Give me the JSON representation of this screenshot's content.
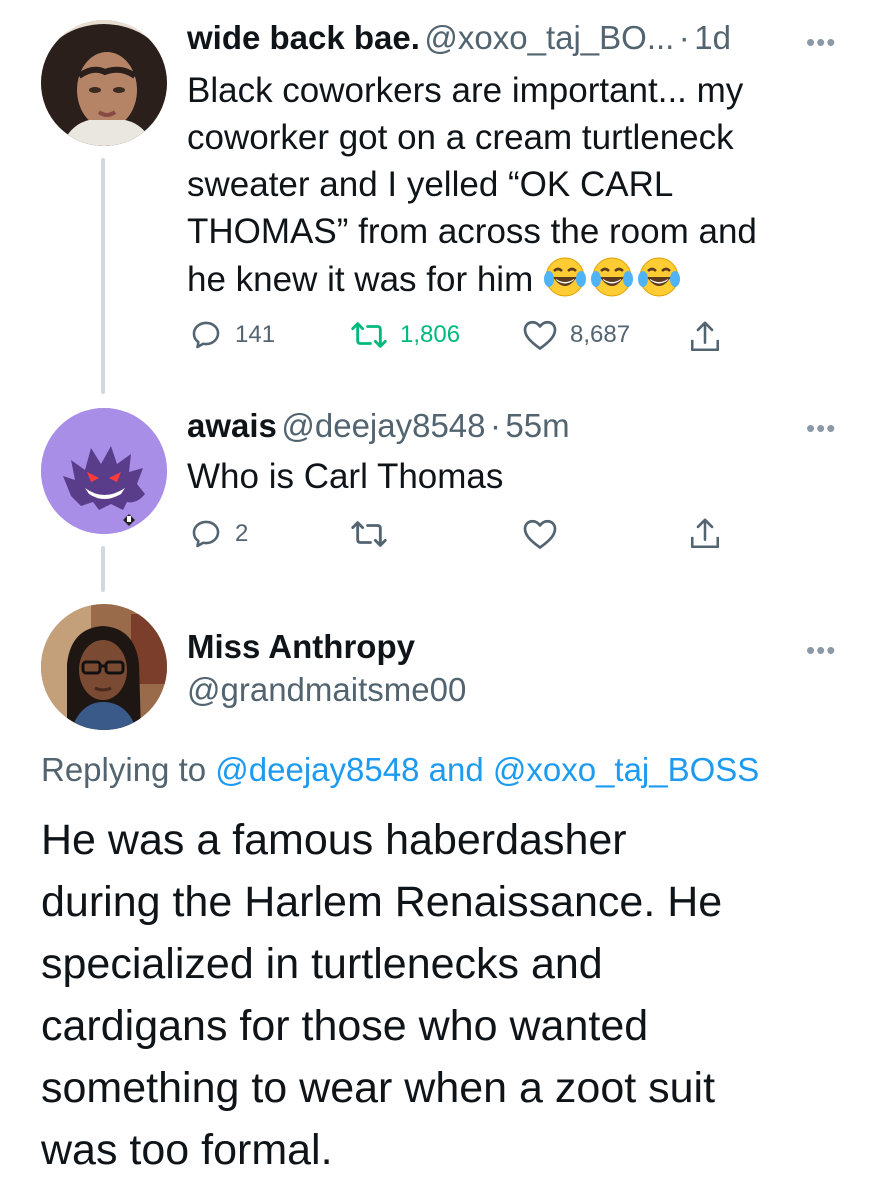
{
  "tweets": [
    {
      "display_name": "wide back bae.",
      "handle": "@xoxo_taj_BO...",
      "sep": "·",
      "time": "1d",
      "text_lines": [
        "Black coworkers are important... my",
        "coworker got on a cream turtleneck",
        "sweater and I yelled “OK CARL",
        "THOMAS” from across the room and",
        "he knew it was for him"
      ],
      "emoji": [
        "face-with-tears-of-joy",
        "face-with-tears-of-joy",
        "face-with-tears-of-joy"
      ],
      "replies": "141",
      "retweets": "1,806",
      "likes": "8,687"
    },
    {
      "display_name": "awais",
      "handle": "@deejay8548",
      "sep": "·",
      "time": "55m",
      "text": "Who is Carl Thomas",
      "replies": "2"
    }
  ],
  "focus_tweet": {
    "display_name": "Miss Anthropy",
    "handle": "@grandmaitsme00",
    "replying_prefix": "Replying to",
    "replying_user1": "@deejay8548",
    "replying_and": "and",
    "replying_user2": "@xoxo_taj_BOSS",
    "text_lines": [
      "He was a famous haberdasher",
      "during the Harlem Renaissance. He",
      "specialized in turtlenecks and",
      "cardigans for those who wanted",
      "something to wear when a zoot suit",
      "was too formal."
    ]
  },
  "more_glyph": "•••",
  "colors": {
    "text": "#0f1419",
    "secondary": "#536471",
    "link": "#1d9bf0",
    "retweet_green": "#00ba7c",
    "thread_line": "#cfd9de",
    "avatar_purple": "#a98ee8"
  }
}
